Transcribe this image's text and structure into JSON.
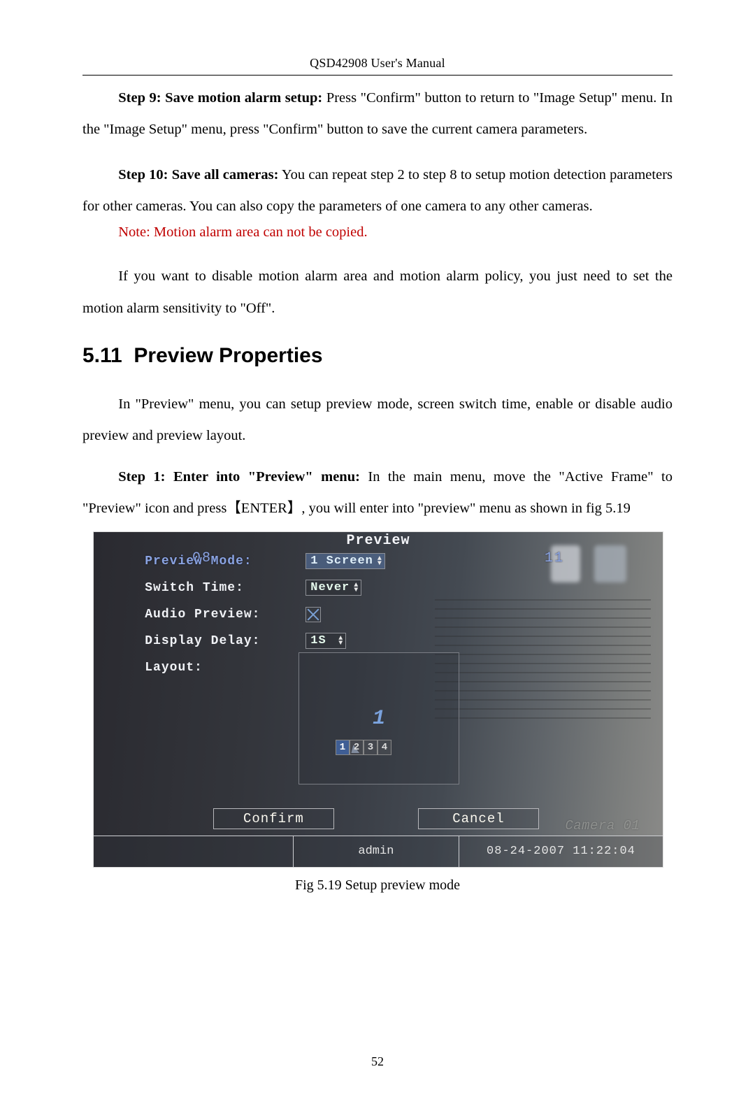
{
  "header": "QSD42908 User's Manual",
  "para1_bold": "Step 9: Save motion alarm setup:",
  "para1_rest": " Press \"Confirm\" button to return to \"Image Setup\" menu. In the \"Image Setup\" menu, press \"Confirm\" button to save the current camera parameters.",
  "para2_bold": "Step 10: Save all cameras:",
  "para2_rest": " You can repeat step 2 to step 8 to setup motion detection parameters for other cameras. You can also copy the parameters of one camera to any other cameras.",
  "note_red": "Note: Motion alarm area can not be copied.",
  "para3": "If you want to disable motion alarm area and motion alarm policy, you just need to set the motion alarm sensitivity to \"Off\".",
  "section_number": "5.11",
  "section_title": "Preview Properties",
  "intro": "In \"Preview\" menu, you can setup preview mode, screen switch time, enable or disable audio preview and preview layout.",
  "step1_bold": "Step 1: Enter into \"Preview\" menu:",
  "step1_rest": " In the main menu, move the \"Active Frame\" to \"Preview\" icon and press【ENTER】, you will enter into \"preview\" menu as shown in fig 5.19",
  "shot": {
    "title": "Preview",
    "legend_left": "08",
    "legend_right": "11",
    "labels": {
      "preview_mode": "Preview Mode:",
      "switch_time": "Switch Time:",
      "audio": "Audio Preview:",
      "delay": "Display Delay:",
      "layout": "Layout:"
    },
    "values": {
      "preview_mode": "1 Screen",
      "switch_time": "Never",
      "delay": "1S"
    },
    "layout_number": "1",
    "palette": [
      "1",
      "2",
      "3",
      "4"
    ],
    "buttons": {
      "confirm": "Confirm",
      "cancel": "Cancel"
    },
    "status": {
      "user": "admin",
      "datetime": "08-24-2007 11:22:04"
    },
    "ghost": "Camera 01"
  },
  "caption": "Fig 5.19 Setup preview mode",
  "page_number": "52"
}
